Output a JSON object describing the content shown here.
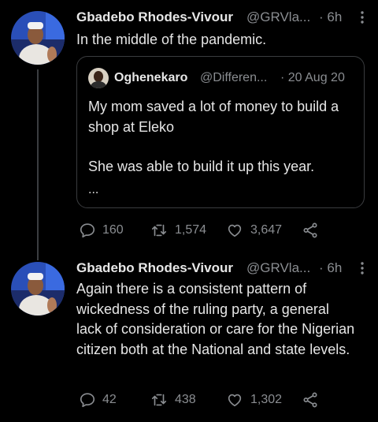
{
  "colors": {
    "background": "#000000",
    "text": "#e6e6e6",
    "muted": "#8a8d91",
    "border": "#3a3c3f"
  },
  "tweets": [
    {
      "name": "Gbadebo Rhodes-Vivour",
      "handle": "@GRVla...",
      "time": "· 6h",
      "text": "In the middle of the pandemic.",
      "quote": {
        "name": "Oghenekaro",
        "handle": "@Differen...",
        "date": "· 20 Aug 20",
        "paragraphs": [
          "My mom saved a lot of money to build a shop at Eleko",
          "She was able to build it up this year."
        ],
        "ellipsis": "..."
      },
      "replies": "160",
      "retweets": "1,574",
      "likes": "3,647",
      "icons": [
        "reply-icon",
        "retweet-icon",
        "like-icon",
        "share-icon",
        "more-icon"
      ]
    },
    {
      "name": "Gbadebo Rhodes-Vivour",
      "handle": "@GRVla...",
      "time": "· 6h",
      "text": "Again there is a consistent pattern of wickedness of the ruling party, a general lack of consideration or care for the Nigerian citizen both at the National and state levels.",
      "replies": "42",
      "retweets": "438",
      "likes": "1,302",
      "icons": [
        "reply-icon",
        "retweet-icon",
        "like-icon",
        "share-icon",
        "more-icon"
      ]
    }
  ]
}
